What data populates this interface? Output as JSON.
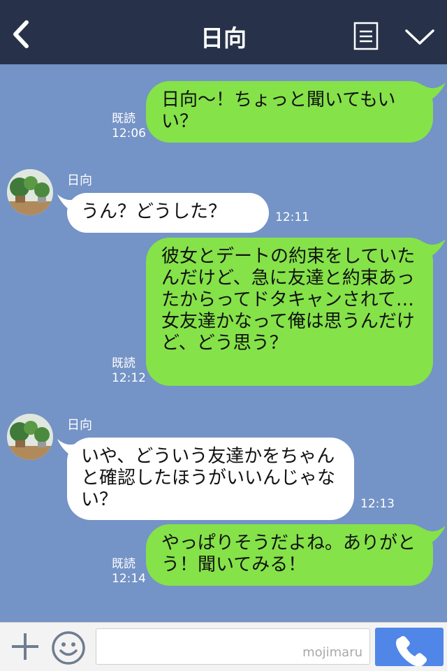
{
  "header": {
    "title": "日向",
    "back_icon": "chevron-left-icon",
    "notes_icon": "notes-icon",
    "collapse_icon": "chevron-down-icon"
  },
  "messages": [
    {
      "direction": "out",
      "text": "日向〜！ちょっと聞いてもいい？",
      "read": "既読",
      "time": "12:06"
    },
    {
      "direction": "in",
      "sender": "日向",
      "text": "うん？どうした？",
      "time": "12:11"
    },
    {
      "direction": "out",
      "text": "彼女とデートの約束をしていたんだけど、急に友達と約束あったからってドタキャンされて…女友達かなって俺は思うんだけど、どう思う？",
      "read": "既読",
      "time": "12:12"
    },
    {
      "direction": "in",
      "sender": "日向",
      "text": "いや、どういう友達かをちゃんと確認したほうがいいんじゃない？",
      "time": "12:13"
    },
    {
      "direction": "out",
      "text": "やっぱりそうだよね。ありがとう！聞いてみる！",
      "read": "既読",
      "time": "12:14"
    }
  ],
  "input_bar": {
    "plus_icon": "plus-icon",
    "emoji_icon": "smiley-icon",
    "watermark": "mojimaru",
    "call_icon": "phone-icon"
  },
  "colors": {
    "header_bg": "#27324a",
    "chat_bg": "#7493c6",
    "outgoing_bubble": "#85e249",
    "incoming_bubble": "#ffffff",
    "call_button": "#4f86e8"
  }
}
